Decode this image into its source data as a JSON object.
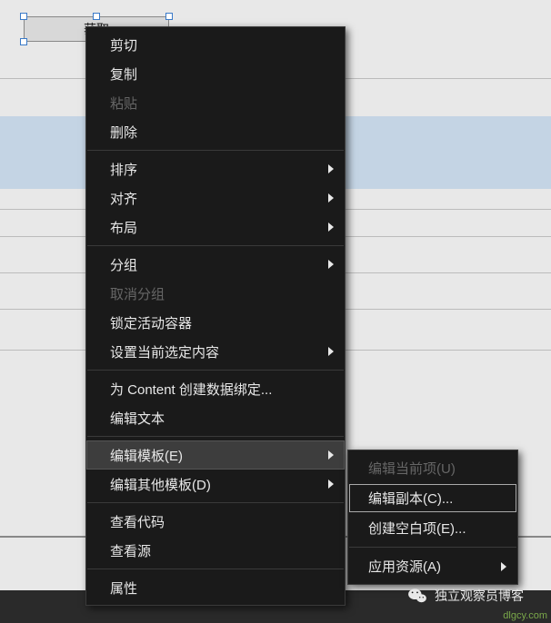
{
  "selected_element": {
    "label": "获取"
  },
  "context_menu": {
    "cut": "剪切",
    "copy": "复制",
    "paste": "粘贴",
    "delete": "删除",
    "order": "排序",
    "align": "对齐",
    "layout": "布局",
    "group": "分组",
    "ungroup": "取消分组",
    "lock_container": "锁定活动容器",
    "set_current_selection": "设置当前选定内容",
    "create_databinding": "为 Content 创建数据绑定...",
    "edit_text": "编辑文本",
    "edit_template": "编辑模板(E)",
    "edit_other_templates": "编辑其他模板(D)",
    "view_code": "查看代码",
    "view_source": "查看源",
    "properties": "属性"
  },
  "submenu": {
    "edit_current": "编辑当前项(U)",
    "edit_copy": "编辑副本(C)...",
    "create_empty": "创建空白项(E)...",
    "apply_resource": "应用资源(A)"
  },
  "watermark": {
    "text": "独立观察员博客",
    "url": "dlgcy.com"
  }
}
